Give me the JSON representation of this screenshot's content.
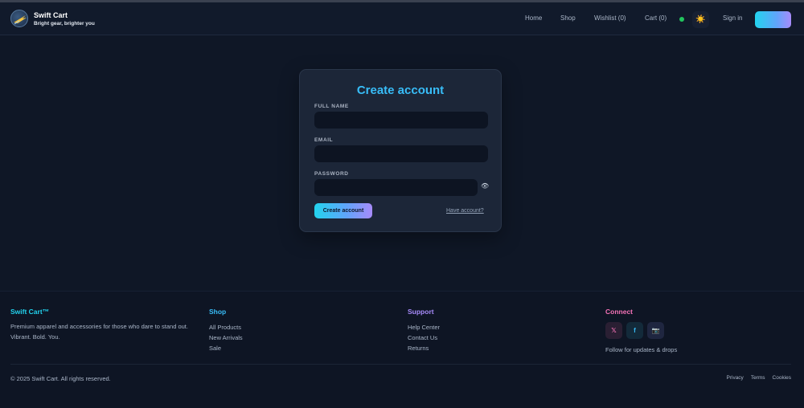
{
  "brand": {
    "name": "Swift Cart",
    "tagline": "Bright gear, brighter you"
  },
  "nav": {
    "home": "Home",
    "shop": "Shop",
    "wishlist": "Wishlist (0)",
    "cart": "Cart (0)",
    "theme_icon": "☀️",
    "sign_in": "Sign in",
    "join": ""
  },
  "form": {
    "title": "Create account",
    "full_name_label": "FULL NAME",
    "full_name_value": "",
    "email_label": "EMAIL",
    "email_value": "",
    "password_label": "PASSWORD",
    "password_value": "",
    "eye_icon": "👁",
    "submit": "Create account",
    "have_account": "Have account?"
  },
  "footer": {
    "brand": "Swift Cart™",
    "description": "Premium apparel and accessories for those who dare to stand out. Vibrant. Bold. You.",
    "shop_heading": "Shop",
    "shop_links": [
      "All Products",
      "New Arrivals",
      "Sale"
    ],
    "support_heading": "Support",
    "support_links": [
      "Help Center",
      "Contact Us",
      "Returns"
    ],
    "connect_heading": "Connect",
    "social": [
      "𝕏",
      "f",
      "📷"
    ],
    "follow_text": "Follow for updates & drops",
    "copyright": "© 2025 Swift Cart. All rights reserved.",
    "legal": [
      "Privacy",
      "Terms",
      "Cookies"
    ]
  },
  "colors": {
    "accent_cyan": "#22d3ee",
    "accent_purple": "#a78bfa",
    "heading_blue": "#38bdf8",
    "connect_pink": "#f472b6",
    "status_green": "#22c55e"
  }
}
